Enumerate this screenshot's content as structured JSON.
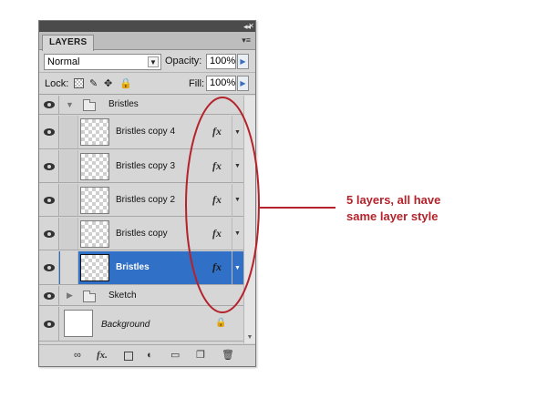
{
  "panel": {
    "title": "LAYERS",
    "blend_mode": "Normal",
    "opacity_label": "Opacity:",
    "opacity_value": "100%",
    "lock_label": "Lock:",
    "fill_label": "Fill:",
    "fill_value": "100%"
  },
  "layers": [
    {
      "name": "Bristles",
      "kind": "group",
      "expanded": true,
      "visible": true
    },
    {
      "name": "Bristles copy 4",
      "kind": "layer",
      "fx": "fx",
      "visible": true
    },
    {
      "name": "Bristles copy 3",
      "kind": "layer",
      "fx": "fx",
      "visible": true
    },
    {
      "name": "Bristles copy 2",
      "kind": "layer",
      "fx": "fx",
      "visible": true
    },
    {
      "name": "Bristles copy",
      "kind": "layer",
      "fx": "fx",
      "visible": true
    },
    {
      "name": "Bristles",
      "kind": "layer",
      "fx": "fx",
      "visible": true,
      "selected": true
    },
    {
      "name": "Sketch",
      "kind": "group",
      "expanded": false,
      "visible": true
    },
    {
      "name": "Background",
      "kind": "background",
      "locked": true,
      "visible": true
    }
  ],
  "footer_icons": [
    "link-icon",
    "fx-icon",
    "mask-icon",
    "adjustment-icon",
    "folder-icon",
    "new-layer-icon",
    "trash-icon"
  ],
  "annotation": {
    "text_line1": "5 layers, all have",
    "text_line2": "same layer style",
    "color": "#b4232b"
  },
  "colors": {
    "selection": "#3070c6",
    "panel_bg": "#d6d6d6",
    "annotation": "#b4232b"
  }
}
